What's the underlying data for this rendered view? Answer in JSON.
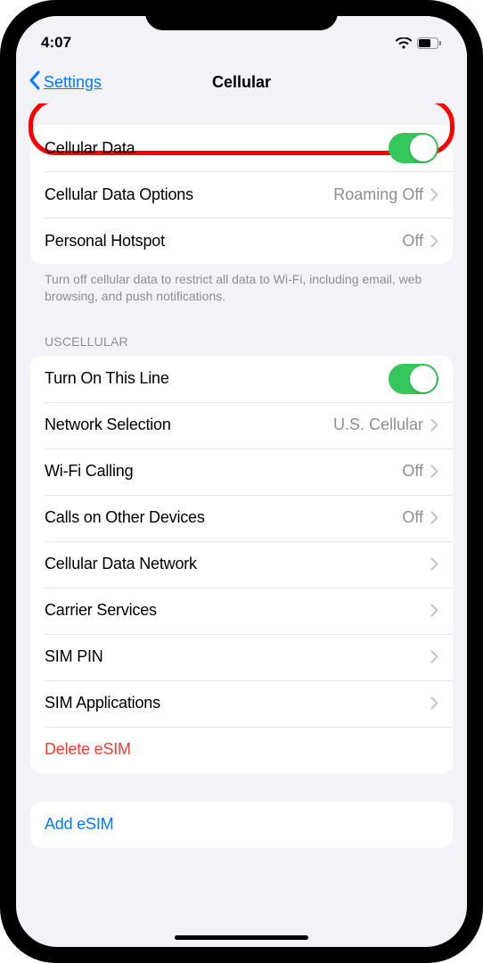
{
  "status": {
    "time": "4:07"
  },
  "nav": {
    "back": "Settings",
    "title": "Cellular"
  },
  "section1": {
    "cellular_data": "Cellular Data",
    "cellular_data_options": "Cellular Data Options",
    "cellular_data_options_val": "Roaming Off",
    "personal_hotspot": "Personal Hotspot",
    "personal_hotspot_val": "Off",
    "footer": "Turn off cellular data to restrict all data to Wi-Fi, including email, web browsing, and push notifications."
  },
  "section2": {
    "header": "USCELLULAR",
    "turn_on_line": "Turn On This Line",
    "network_selection": "Network Selection",
    "network_selection_val": "U.S. Cellular",
    "wifi_calling": "Wi-Fi Calling",
    "wifi_calling_val": "Off",
    "calls_other": "Calls on Other Devices",
    "calls_other_val": "Off",
    "cellular_network": "Cellular Data Network",
    "carrier_services": "Carrier Services",
    "sim_pin": "SIM PIN",
    "sim_apps": "SIM Applications",
    "delete_esim": "Delete eSIM"
  },
  "section3": {
    "add_esim": "Add eSIM"
  }
}
